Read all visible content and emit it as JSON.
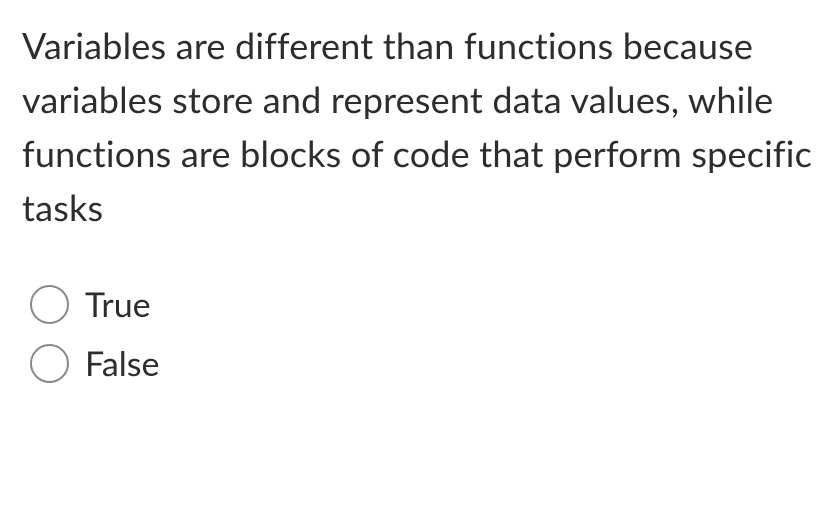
{
  "question": {
    "text": "Variables are different than functions because variables store and represent data values, while functions are blocks of code that perform specific tasks"
  },
  "options": [
    {
      "label": "True"
    },
    {
      "label": "False"
    }
  ]
}
